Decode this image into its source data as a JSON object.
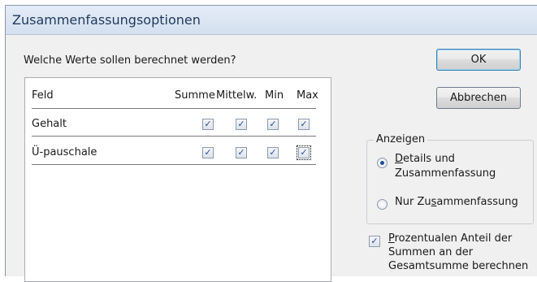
{
  "window": {
    "title": "Zusammenfassungsoptionen"
  },
  "prompt": "Welche Werte sollen berechnet werden?",
  "table": {
    "columns": [
      "Feld",
      "Summe",
      "Mittelw.",
      "Min",
      "Max"
    ],
    "rows": [
      {
        "label": "Gehalt",
        "checked": [
          true,
          true,
          true,
          true
        ]
      },
      {
        "label": "Ü-pauschale",
        "checked": [
          true,
          true,
          true,
          true
        ]
      }
    ]
  },
  "buttons": {
    "ok": "OK",
    "cancel": "Abbrechen"
  },
  "display_group": {
    "legend": "Anzeigen",
    "option1": {
      "underlined": "D",
      "rest_line1": "etails und",
      "line2": "Zusammenfassung",
      "selected": true
    },
    "option2": {
      "before": "Nur Zu",
      "underlined": "s",
      "after": "ammenfassung",
      "selected": false
    }
  },
  "percent_option": {
    "checked": true,
    "underlined": "P",
    "line1_rest": "rozentualen Anteil der",
    "line2": "Summen an der",
    "line3": "Gesamtsumme berechnen"
  },
  "check_glyph": "✓"
}
